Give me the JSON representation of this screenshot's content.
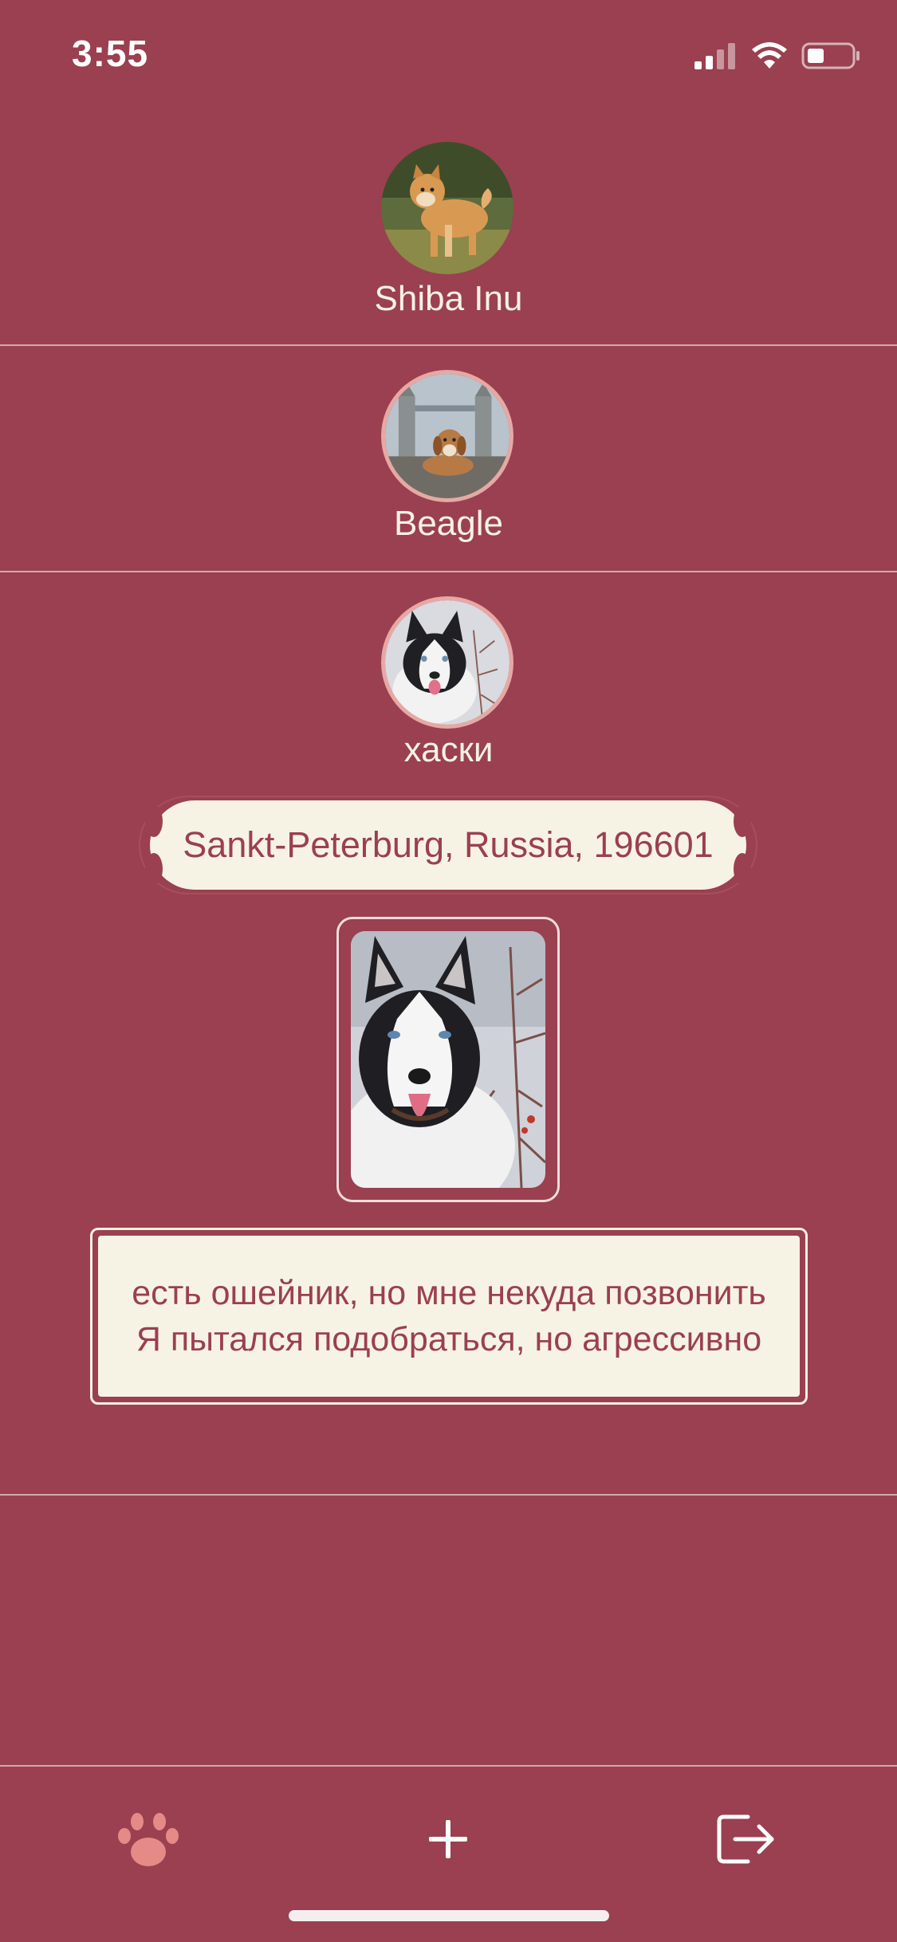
{
  "status_bar": {
    "time": "3:55",
    "icons": [
      "cellular-signal-icon",
      "wifi-icon",
      "battery-icon"
    ]
  },
  "dogs": [
    {
      "name": "Shiba Inu",
      "avatar": "shiba-inu-photo"
    },
    {
      "name": "Beagle",
      "avatar": "beagle-photo"
    },
    {
      "name": "хаски",
      "avatar": "husky-photo"
    }
  ],
  "detail": {
    "address": "Sankt-Peterburg, Russia, 196601",
    "photo": "husky-photo",
    "description": "есть ошейник, но мне некуда позвонить Я пытался подобраться, но агрессивно"
  },
  "tab_bar": {
    "items": [
      {
        "icon": "paw-icon",
        "active": true
      },
      {
        "icon": "plus-icon",
        "active": false
      },
      {
        "icon": "logout-icon",
        "active": false
      }
    ]
  },
  "colors": {
    "background": "#9a4050",
    "cream": "#f7f3e4",
    "accent_pink": "#e58a86"
  }
}
